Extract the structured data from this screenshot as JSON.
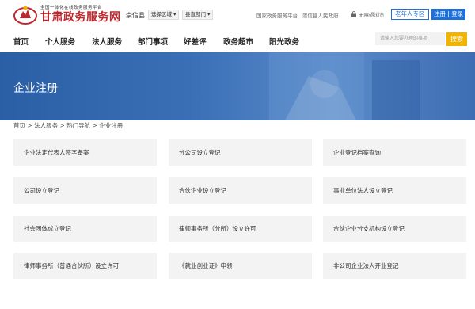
{
  "header": {
    "logo_subtitle": "全国一体化在线政务服务平台",
    "logo_title": "甘肃政务服务网",
    "region": "崇信县",
    "select_region": "选择区域",
    "select_dept": "县直部门",
    "links": [
      "国家政务服务平台",
      "崇信县人民政府"
    ],
    "accessibility": "无障碍浏览",
    "elder_button": "老年人专区",
    "login_button": "注册 | 登录"
  },
  "nav": {
    "items": [
      "首页",
      "个人服务",
      "法人服务",
      "部门事项",
      "好差评",
      "政务超市",
      "阳光政务"
    ],
    "search_placeholder": "请输入您要办理的事项",
    "search_button": "搜索"
  },
  "banner": {
    "title": "企业注册"
  },
  "breadcrumb": {
    "items": [
      "首页",
      "法人服务",
      "热门导航",
      "企业注册"
    ],
    "separator": ">"
  },
  "services": [
    "企业法定代表人签字备案",
    "分公司设立登记",
    "企业登记档案查询",
    "公司设立登记",
    "合伙企业设立登记",
    "事业单位法人设立登记",
    "社会团体成立登记",
    "律师事务所（分所）设立许可",
    "合伙企业分支机构设立登记",
    "律师事务所（普通合伙所）设立许可",
    "《就业创业证》申领",
    "非公司企业法人开业登记"
  ],
  "colors": {
    "brand_red": "#c0272d",
    "accent_blue": "#1e6fd9",
    "search_yellow": "#f2b400",
    "banner_blue": "#3a6fb6",
    "card_bg": "#f3f3f3"
  }
}
